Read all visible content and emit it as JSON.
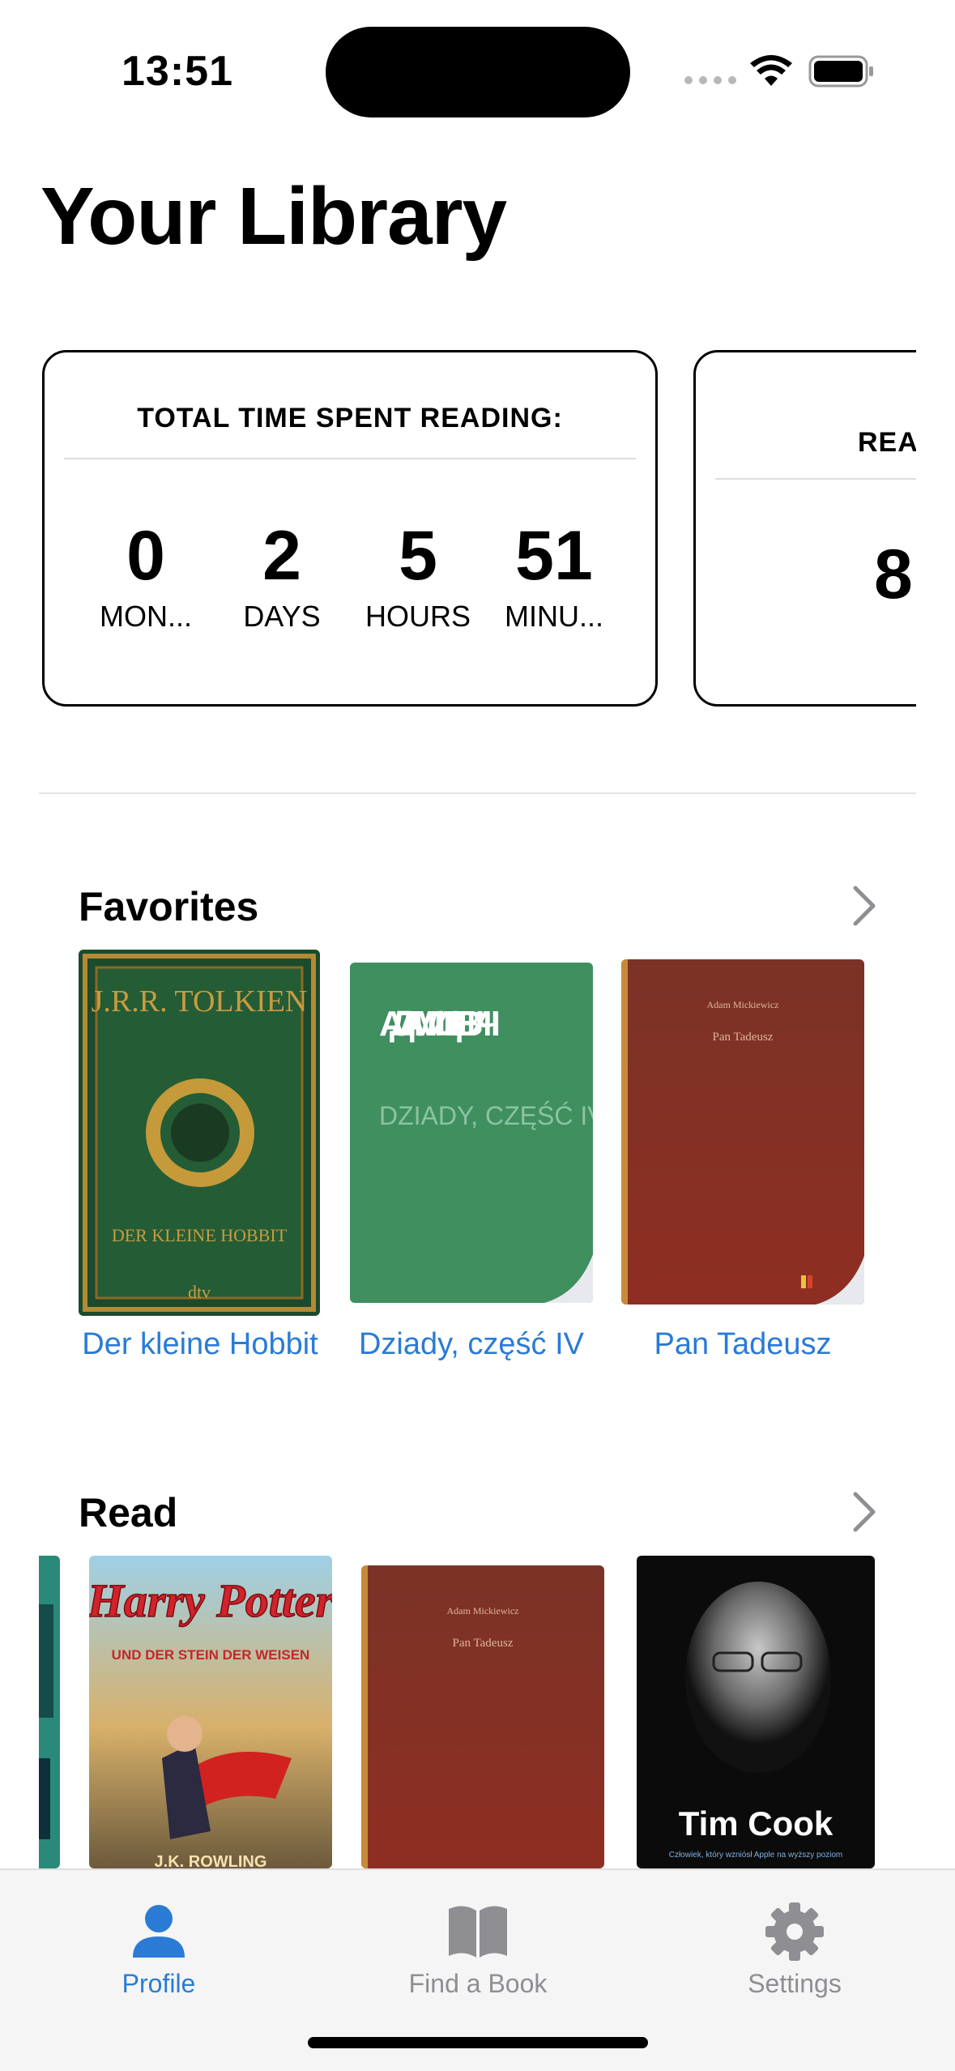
{
  "status_bar": {
    "time": "13:51"
  },
  "title": "Your Library",
  "reading_card": {
    "header": "TOTAL TIME SPENT READING:",
    "units": [
      {
        "value": "0",
        "label": "MON..."
      },
      {
        "value": "2",
        "label": "DAYS"
      },
      {
        "value": "5",
        "label": "HOURS"
      },
      {
        "value": "51",
        "label": "MINU..."
      }
    ]
  },
  "second_card": {
    "header": "REA",
    "value": "8"
  },
  "favorites": {
    "title": "Favorites",
    "books": [
      {
        "title": "Der kleine Hobbit",
        "cover_author": "J.R.R. TOLKIEN",
        "cover_title": "DER KLEINE HOBBIT",
        "cover_publisher": "dtv"
      },
      {
        "title": "Dziady, część IV",
        "cover_author": "АДАМ МИЦКЕВИЧ",
        "cover_title": "DZIADY, CZĘŚĆ IV"
      },
      {
        "title": "Pan Tadeusz",
        "cover_author": "Adam Mickiewicz",
        "cover_title": "Pan Tadeusz"
      }
    ]
  },
  "read": {
    "title": "Read",
    "books": [
      {
        "cover_title": "Harry Potter",
        "cover_subtitle": "UND DER STEIN DER WEISEN",
        "cover_author": "J.K. ROWLING"
      },
      {
        "cover_author": "Adam Mickiewicz",
        "cover_title": "Pan Tadeusz"
      },
      {
        "cover_title": "Tim Cook",
        "cover_subtitle": "Człowiek, który wzniósł Apple na wyższy poziom"
      }
    ]
  },
  "tabs": [
    {
      "label": "Profile",
      "icon": "person-icon",
      "active": true
    },
    {
      "label": "Find a Book",
      "icon": "book-icon",
      "active": false
    },
    {
      "label": "Settings",
      "icon": "gear-icon",
      "active": false
    }
  ],
  "colors": {
    "accent": "#2a7bd6",
    "inactive": "#8e8e93"
  }
}
